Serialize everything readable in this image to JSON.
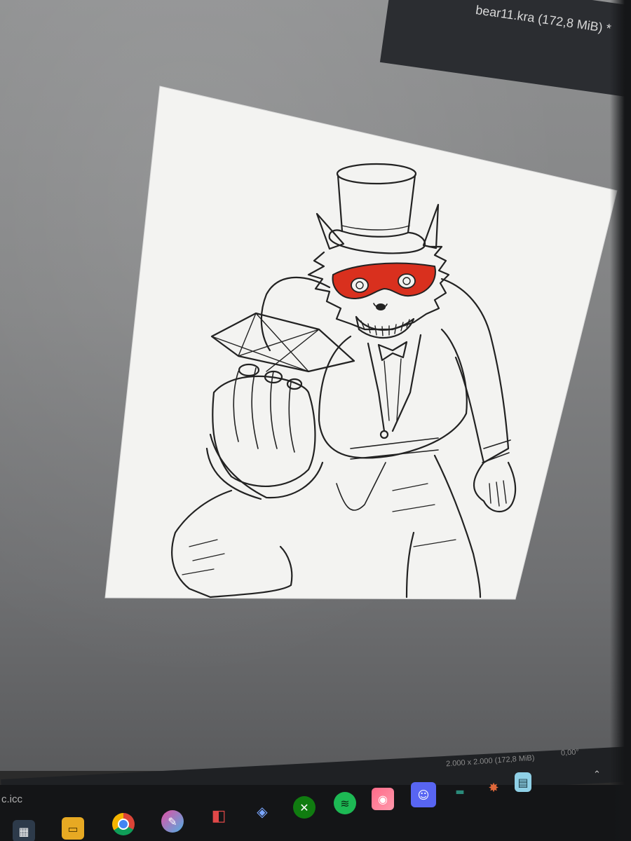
{
  "window": {
    "title": "bear11.kra (172,8 MiB) *"
  },
  "statusbar": {
    "image_size": "2.000 x 2.000 (172,8 MiB)",
    "rotation": "0,00°",
    "color_profile": "c.icc"
  },
  "taskbar": {
    "apps": [
      {
        "name": "windows-store-icon"
      },
      {
        "name": "file-explorer-icon"
      },
      {
        "name": "chrome-icon"
      },
      {
        "name": "krita-icon"
      },
      {
        "name": "nintendo-switch-icon"
      },
      {
        "name": "hoyoverse-icon"
      },
      {
        "name": "xbox-icon"
      },
      {
        "name": "spotify-icon"
      },
      {
        "name": "camera-app-icon"
      },
      {
        "name": "discord-icon"
      },
      {
        "name": "network-icon"
      },
      {
        "name": "volume-icon"
      },
      {
        "name": "notification-icon"
      }
    ]
  },
  "colors": {
    "canvas_paper": "#f4f4f2",
    "mask_red": "#d9301e",
    "ink": "#222222",
    "workspace_gray": "#8a8b8c"
  }
}
